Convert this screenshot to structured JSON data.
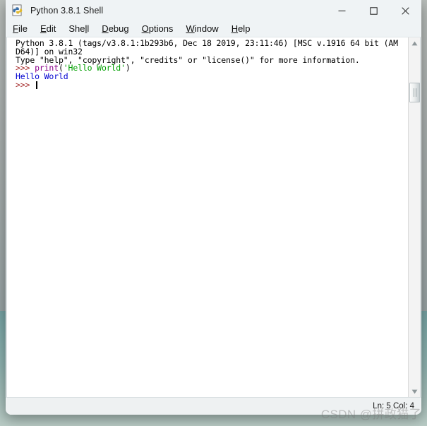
{
  "window": {
    "title": "Python 3.8.1 Shell",
    "icon": "python-idle-icon",
    "controls": {
      "minimize": "Minimize",
      "maximize": "Maximize",
      "close": "Close"
    }
  },
  "menubar": {
    "items": [
      {
        "label": "File",
        "mnemonic": "F"
      },
      {
        "label": "Edit",
        "mnemonic": "E"
      },
      {
        "label": "Shell",
        "mnemonic": "l"
      },
      {
        "label": "Debug",
        "mnemonic": "D"
      },
      {
        "label": "Options",
        "mnemonic": "O"
      },
      {
        "label": "Window",
        "mnemonic": "W"
      },
      {
        "label": "Help",
        "mnemonic": "H"
      }
    ]
  },
  "console": {
    "lines": [
      {
        "spans": [
          {
            "text": "Python 3.8.1 (tags/v3.8.1:1b293b6, Dec 18 2019, 23:11:46) [MSC v.1916 64 bit (AM",
            "style": "plain"
          }
        ]
      },
      {
        "spans": [
          {
            "text": "D64)] on win32",
            "style": "plain"
          }
        ]
      },
      {
        "spans": [
          {
            "text": "Type \"help\", \"copyright\", \"credits\" or \"license()\" for more information.",
            "style": "plain"
          }
        ]
      },
      {
        "spans": [
          {
            "text": ">>> ",
            "style": "prompt"
          },
          {
            "text": "print",
            "style": "builtin"
          },
          {
            "text": "(",
            "style": "plain"
          },
          {
            "text": "'Hello World'",
            "style": "string"
          },
          {
            "text": ")",
            "style": "plain"
          }
        ]
      },
      {
        "spans": [
          {
            "text": "Hello World",
            "style": "output"
          }
        ]
      },
      {
        "spans": [
          {
            "text": ">>> ",
            "style": "prompt"
          }
        ],
        "caret": true
      }
    ]
  },
  "scrollbar": {
    "up_arrow": "scroll-up-arrow",
    "down_arrow": "scroll-down-arrow",
    "thumb": "scroll-thumb"
  },
  "statusbar": {
    "text": "Ln: 5 Col: 4",
    "line": 5,
    "column": 4
  },
  "watermark": {
    "text": "CSDN @拼政猫了"
  },
  "colors": {
    "prompt": "#a52a2a",
    "builtin": "#8b008b",
    "string": "#00a000",
    "output": "#0000d0",
    "plain": "#000000",
    "titlebar_bg": "#eff3f5",
    "console_bg": "#ffffff"
  }
}
